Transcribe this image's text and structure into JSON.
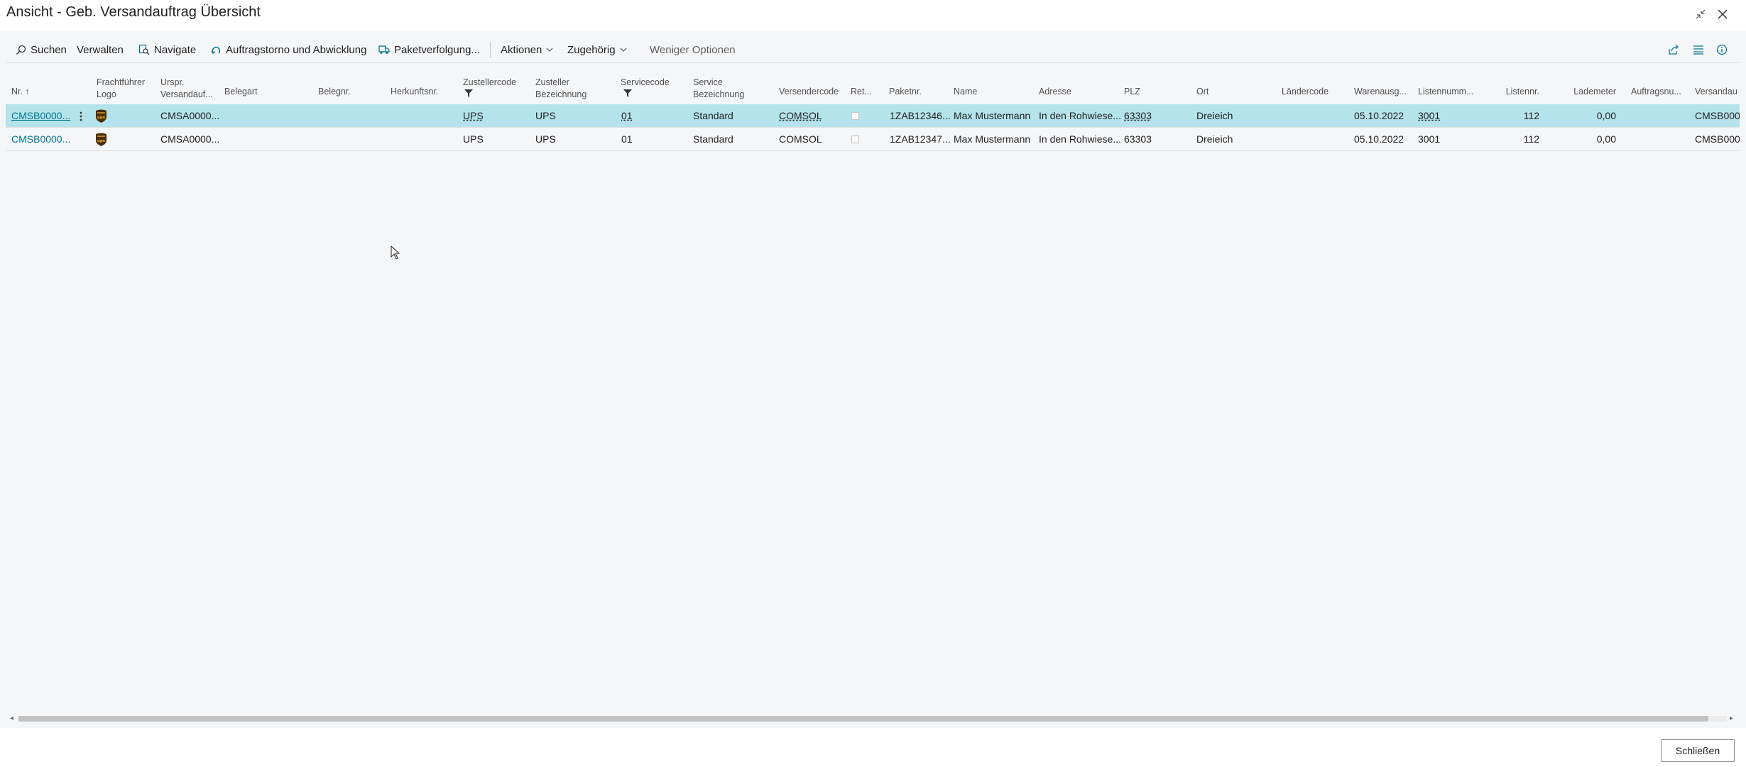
{
  "window": {
    "title": "Ansicht - Geb. Versandauftrag Übersicht"
  },
  "toolbar": {
    "search": "Suchen",
    "manage": "Verwalten",
    "navigate": "Navigate",
    "cancel": "Auftragstorno und Abwicklung",
    "tracking": "Paketverfolgung...",
    "actions": "Aktionen",
    "related": "Zugehörig",
    "fewer": "Weniger Optionen"
  },
  "columns": {
    "nr": "Nr. ↑",
    "carrier_logo_1": "Frachtführer",
    "carrier_logo_2": "Logo",
    "orig_1": "Urspr.",
    "orig_2": "Versandauf...",
    "belegart": "Belegart",
    "belegnr": "Belegnr.",
    "herkunft": "Herkunftsnr.",
    "zustellercode": "Zustellercode",
    "zusteller_1": "Zusteller",
    "zusteller_2": "Bezeichnung",
    "servicecode": "Servicecode",
    "service_1": "Service",
    "service_2": "Bezeichnung",
    "versendercode": "Versendercode",
    "ret": "Ret...",
    "paketnr": "Paketnr.",
    "name": "Name",
    "adresse": "Adresse",
    "plz": "PLZ",
    "ort": "Ort",
    "laendercode": "Ländercode",
    "warenausg": "Warenausg...",
    "listennumm": "Listennumm...",
    "listennr": "Listennr.",
    "lademeter": "Lademeter",
    "auftragsnu": "Auftragsnu...",
    "versandau": "Versandau"
  },
  "rows": [
    {
      "nr": "CMSB0000...",
      "orig": "CMSA0000...",
      "belegart": "",
      "belegnr": "",
      "herkunft": "",
      "zustellercode": "UPS",
      "zusteller": "UPS",
      "servicecode": "01",
      "service": "Standard",
      "versendercode": "COMSOL",
      "paketnr": "1ZAB12346...",
      "name": "Max Mustermann",
      "adresse": "In den Rohwiese...",
      "plz": "63303",
      "ort": "Dreieich",
      "laendercode": "",
      "warenausg": "05.10.2022",
      "listennumm": "3001",
      "listennr": "112",
      "lademeter": "0,00",
      "auftragsnu": "",
      "versandau": "CMSB000"
    },
    {
      "nr": "CMSB0000...",
      "orig": "CMSA0000...",
      "belegart": "",
      "belegnr": "",
      "herkunft": "",
      "zustellercode": "UPS",
      "zusteller": "UPS",
      "servicecode": "01",
      "service": "Standard",
      "versendercode": "COMSOL",
      "paketnr": "1ZAB12347...",
      "name": "Max Mustermann",
      "adresse": "In den Rohwiese...",
      "plz": "63303",
      "ort": "Dreieich",
      "laendercode": "",
      "warenausg": "05.10.2022",
      "listennumm": "3001",
      "listennr": "112",
      "lademeter": "0,00",
      "auftragsnu": "",
      "versandau": "CMSB000"
    }
  ],
  "footer": {
    "close": "Schließen"
  },
  "colors": {
    "accent": "#00758f",
    "selected_row": "#b4e3eb"
  }
}
